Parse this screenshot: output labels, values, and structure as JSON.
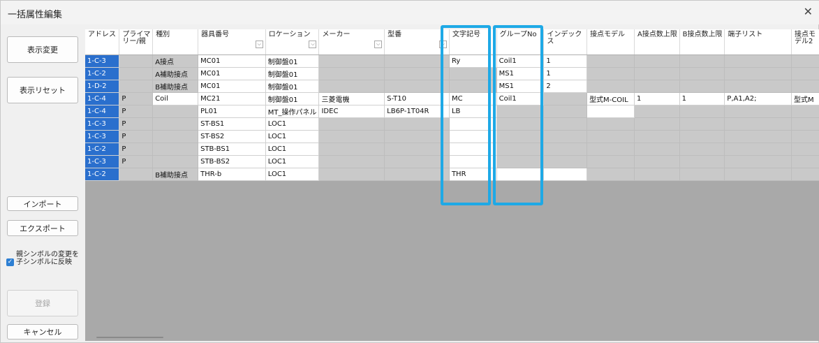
{
  "window": {
    "title": "一括属性編集"
  },
  "icons": {
    "close": "close-icon",
    "dropdown": "chevron-down-icon",
    "check": "check-icon"
  },
  "buttons": {
    "display_change": "表示変更",
    "display_reset": "表示リセット",
    "import": "インポート",
    "export": "エクスポート",
    "register": "登録",
    "cancel": "キャンセル"
  },
  "checkbox": {
    "label": "親シンボルの変更を子シンボルに反映",
    "checked": true
  },
  "colors": {
    "highlight": "#1ea9e6",
    "selected": "#2a6fcd",
    "readonly": "#c9c9c9"
  },
  "table": {
    "columns": [
      {
        "label": "アドレス",
        "filter": false
      },
      {
        "label": "プライマリー/親",
        "filter": false
      },
      {
        "label": "種別",
        "filter": false
      },
      {
        "label": "器具番号",
        "filter": true
      },
      {
        "label": "ロケーション",
        "filter": true
      },
      {
        "label": "メーカー",
        "filter": true
      },
      {
        "label": "型番",
        "filter": true
      },
      {
        "label": "文字記号",
        "filter": false
      },
      {
        "label": "グループNo",
        "filter": false
      },
      {
        "label": "インデックス",
        "filter": false
      },
      {
        "label": "接点モデル",
        "filter": false
      },
      {
        "label": "A接点数上限",
        "filter": false
      },
      {
        "label": "B接点数上限",
        "filter": false
      },
      {
        "label": "端子リスト",
        "filter": false
      },
      {
        "label": "接点モデル2",
        "filter": false
      }
    ],
    "rows": [
      [
        "1-C-3",
        "",
        "A接点",
        "MC01",
        "制御盤01",
        "",
        "",
        "Ry",
        "Coil1",
        "1",
        "",
        "",
        "",
        "",
        ""
      ],
      [
        "1-C-2",
        "",
        "A補助接点",
        "MC01",
        "制御盤01",
        "",
        "",
        "",
        "MS1",
        "1",
        "",
        "",
        "",
        "",
        ""
      ],
      [
        "1-D-2",
        "",
        "B補助接点",
        "MC01",
        "制御盤01",
        "",
        "",
        "",
        "MS1",
        "2",
        "",
        "",
        "",
        "",
        ""
      ],
      [
        "1-C-4",
        "P",
        "Coil",
        "MC21",
        "制御盤01",
        "三菱電機",
        "S-T10",
        "MC",
        "Coil1",
        "",
        "型式M-COIL",
        "1",
        "1",
        "P,A1,A2;",
        "型式M"
      ],
      [
        "1-C-4",
        "P",
        "",
        "PL01",
        "MT_操作パネル",
        "IDEC",
        "LB6P-1T04R",
        "LB",
        "",
        "",
        "",
        "",
        "",
        "",
        ""
      ],
      [
        "1-C-3",
        "P",
        "",
        "ST-BS1",
        "LOC1",
        "",
        "",
        "",
        "",
        "",
        "",
        "",
        "",
        "",
        ""
      ],
      [
        "1-C-3",
        "P",
        "",
        "ST-BS2",
        "LOC1",
        "",
        "",
        "",
        "",
        "",
        "",
        "",
        "",
        "",
        ""
      ],
      [
        "1-C-2",
        "P",
        "",
        "STB-BS1",
        "LOC1",
        "",
        "",
        "",
        "",
        "",
        "",
        "",
        "",
        "",
        ""
      ],
      [
        "1-C-3",
        "P",
        "",
        "STB-BS2",
        "LOC1",
        "",
        "",
        "",
        "",
        "",
        "",
        "",
        "",
        "",
        ""
      ],
      [
        "1-C-2",
        "",
        "B補助接点",
        "THR-b",
        "LOC1",
        "",
        "",
        "THR",
        "",
        "",
        "",
        "",
        "",
        "",
        ""
      ]
    ]
  }
}
